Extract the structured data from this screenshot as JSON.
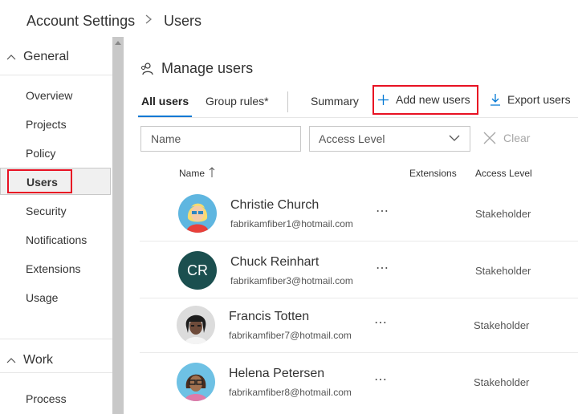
{
  "breadcrumb": {
    "root": "Account Settings",
    "current": "Users"
  },
  "sidebar": {
    "groups": [
      {
        "label": "General",
        "items": [
          "Overview",
          "Projects",
          "Policy",
          "Users",
          "Security",
          "Notifications",
          "Extensions",
          "Usage"
        ]
      },
      {
        "label": "Work",
        "items": [
          "Process"
        ]
      }
    ],
    "selected": "Users"
  },
  "main": {
    "title": "Manage users",
    "tabs": [
      {
        "label": "All users",
        "selected": true
      },
      {
        "label": "Group rules*",
        "selected": false
      },
      {
        "label": "Summary",
        "selected": false
      }
    ],
    "actions": {
      "add": "Add new users",
      "export": "Export users"
    },
    "filters": {
      "name_placeholder": "Name",
      "access_level_label": "Access Level",
      "clear_label": "Clear"
    },
    "table": {
      "columns": {
        "name": "Name",
        "extensions": "Extensions",
        "access_level": "Access Level"
      },
      "rows": [
        {
          "name": "Christie Church",
          "email": "fabrikamfiber1@hotmail.com",
          "more": "⋯",
          "access_level": "Stakeholder",
          "avatar": "photo-blonde-woman"
        },
        {
          "name": "Chuck Reinhart",
          "email": "fabrikamfiber3@hotmail.com",
          "more": "⋯",
          "access_level": "Stakeholder",
          "avatar": "initials",
          "initials": "CR"
        },
        {
          "name": "Francis Totten",
          "email": "fabrikamfiber7@hotmail.com",
          "more": "⋯",
          "access_level": "Stakeholder",
          "avatar": "photo-dreadlocks-man"
        },
        {
          "name": "Helena Petersen",
          "email": "fabrikamfiber8@hotmail.com",
          "more": "⋯",
          "access_level": "Stakeholder",
          "avatar": "photo-glasses-woman"
        }
      ]
    }
  },
  "colors": {
    "accent": "#0078d4",
    "highlight": "#e81123",
    "initials_bg": "#1b4f4f"
  }
}
